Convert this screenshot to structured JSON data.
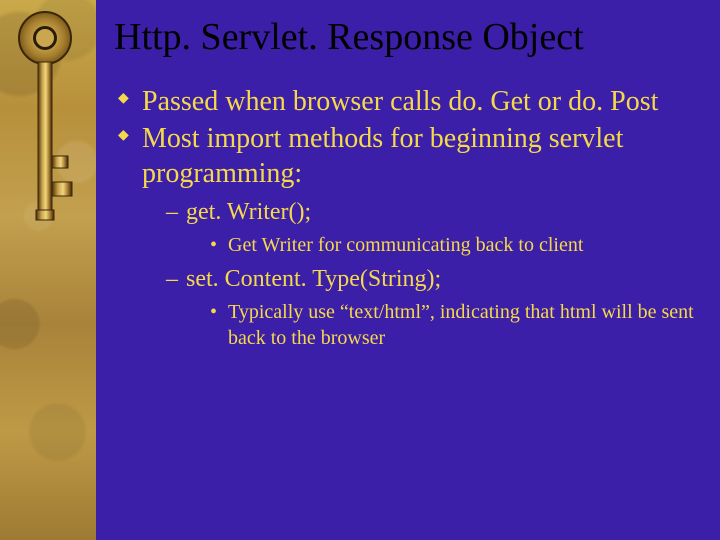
{
  "title": "Http. Servlet. Response Object",
  "bullets": {
    "b1": "Passed when browser calls do. Get or do. Post",
    "b2": "Most import methods for beginning servlet programming:",
    "b2_sub": {
      "s1": "get. Writer();",
      "s1_sub": {
        "d1": "Get Writer for communicating back to client"
      },
      "s2": "set. Content. Type(String);",
      "s2_sub": {
        "d1": "Typically use “text/html”, indicating that html will be sent back to the browser"
      }
    }
  }
}
